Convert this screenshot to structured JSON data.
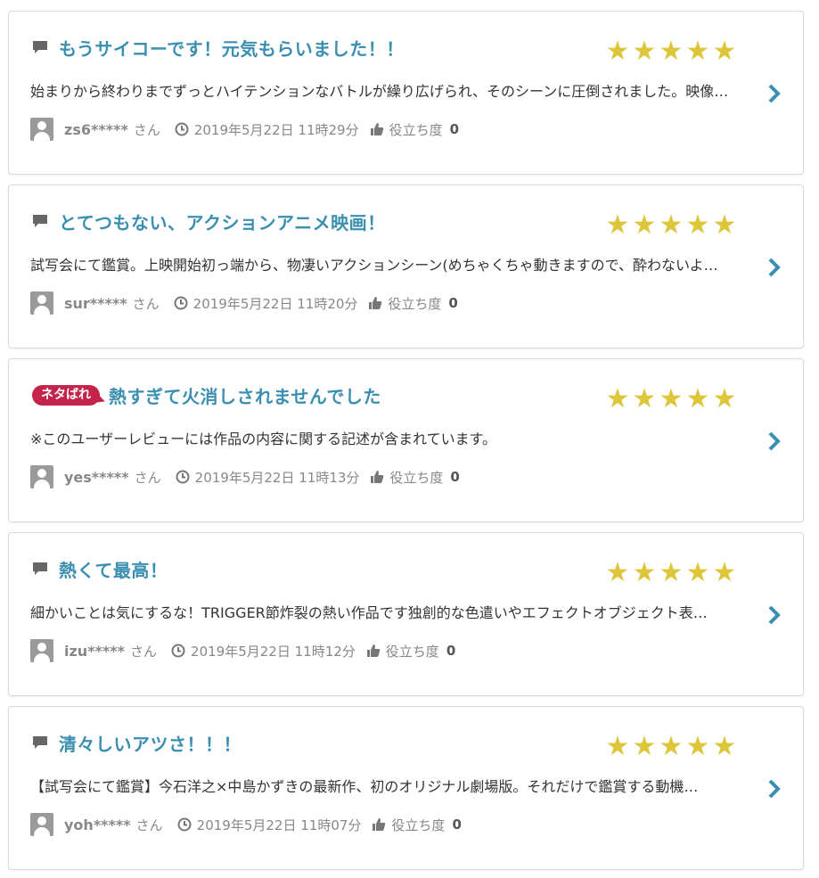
{
  "reviews": [
    {
      "spoiler_label": "",
      "title": "もうサイコーです！元気もらいました！！",
      "rating": 5,
      "body": "始まりから終わりまでずっとハイテンションなバトルが繰り広げられ、そのシーンに圧倒されました。映像…",
      "user": "zs6*****",
      "user_suffix": "さん",
      "date": "2019年5月22日 11時29分",
      "helpful_label": "役立ち度",
      "helpful_count": "0"
    },
    {
      "spoiler_label": "",
      "title": "とてつもない、アクションアニメ映画！",
      "rating": 5,
      "body": "試写会にて鑑賞。上映開始初っ端から、物凄いアクションシーン(めちゃくちゃ動きますので、酔わないよ…",
      "user": "sur*****",
      "user_suffix": "さん",
      "date": "2019年5月22日 11時20分",
      "helpful_label": "役立ち度",
      "helpful_count": "0"
    },
    {
      "spoiler_label": "ネタばれ",
      "title": "熱すぎて火消しされませんでした",
      "rating": 5,
      "body": "※このユーザーレビューには作品の内容に関する記述が含まれています。",
      "user": "yes*****",
      "user_suffix": "さん",
      "date": "2019年5月22日 11時13分",
      "helpful_label": "役立ち度",
      "helpful_count": "0"
    },
    {
      "spoiler_label": "",
      "title": "熱くて最高！",
      "rating": 5,
      "body": "細かいことは気にするな！TRIGGER節炸裂の熱い作品です独創的な色遣いやエフェクトオブジェクト表…",
      "user": "izu*****",
      "user_suffix": "さん",
      "date": "2019年5月22日 11時12分",
      "helpful_label": "役立ち度",
      "helpful_count": "0"
    },
    {
      "spoiler_label": "",
      "title": "清々しいアツさ！！！",
      "rating": 5,
      "body": "【試写会にて鑑賞】今石洋之×中島かずきの最新作、初のオリジナル劇場版。それだけで鑑賞する動機…",
      "user": "yoh*****",
      "user_suffix": "さん",
      "date": "2019年5月22日 11時07分",
      "helpful_label": "役立ち度",
      "helpful_count": "0"
    }
  ],
  "colors": {
    "title": "#3a8fb0",
    "star": "#ddc63a",
    "spoiler_badge": "#c4244b",
    "chevron": "#3a8fb0",
    "meta": "#888888"
  },
  "icons": {
    "title": "comment-icon",
    "date": "clock-icon",
    "helpful": "thumbs-up-icon",
    "avatar": "user-avatar-icon",
    "open": "chevron-right-icon",
    "rating": "star-icon"
  }
}
